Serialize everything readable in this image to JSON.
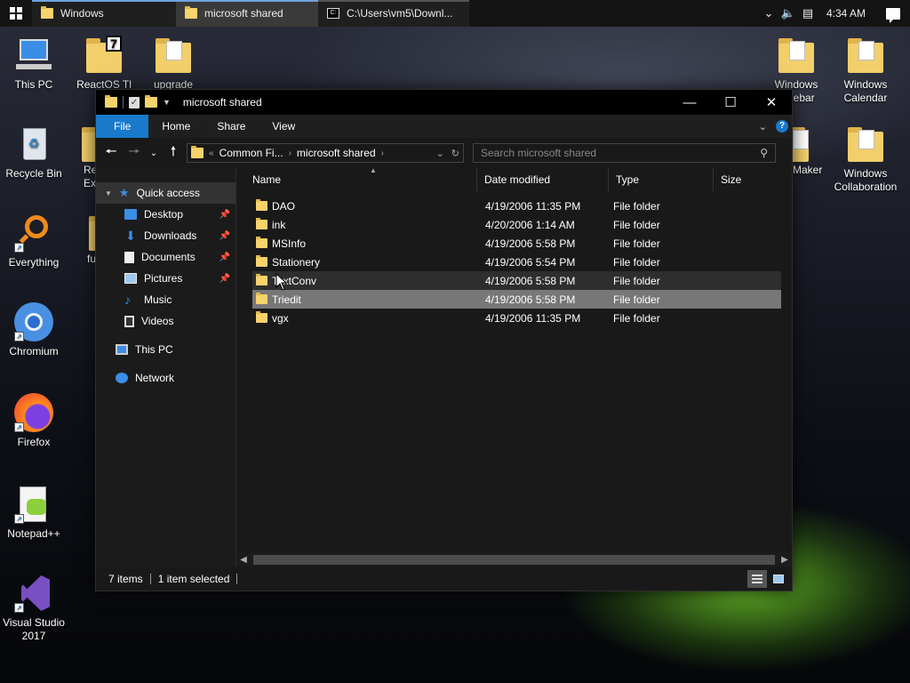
{
  "taskbar": {
    "tasks": [
      {
        "label": "Windows"
      },
      {
        "label": "microsoft shared"
      },
      {
        "label": "C:\\Users\\vm5\\Downl..."
      }
    ],
    "clock": "4:34 AM"
  },
  "desktop": {
    "icons": [
      {
        "label": "This PC"
      },
      {
        "label": "ReactOS Tl"
      },
      {
        "label": "upgrade"
      },
      {
        "label": "Windows Sidebar"
      },
      {
        "label": "Windows Calendar"
      },
      {
        "label": "Recycle Bin"
      },
      {
        "label": "Re Ex"
      },
      {
        "label": "Maker"
      },
      {
        "label": "Windows Collaboration"
      },
      {
        "label": "Everything"
      },
      {
        "label": "fu"
      },
      {
        "label": "Chromium"
      },
      {
        "label": "Firefox"
      },
      {
        "label": "Notepad++"
      },
      {
        "label": "Visual Studio 2017"
      }
    ]
  },
  "explorer": {
    "title": "microsoft shared",
    "ribbon_tabs": [
      "File",
      "Home",
      "Share",
      "View"
    ],
    "address": {
      "overflow": "«",
      "crumbs": [
        "Common Fi...",
        "microsoft shared"
      ]
    },
    "search_placeholder": "Search microsoft shared",
    "nav": {
      "quick_access": "Quick access",
      "items": [
        "Desktop",
        "Downloads",
        "Documents",
        "Pictures",
        "Music",
        "Videos"
      ],
      "this_pc": "This PC",
      "network": "Network"
    },
    "columns": [
      "Name",
      "Date modified",
      "Type",
      "Size"
    ],
    "rows": [
      {
        "name": "DAO",
        "date": "4/19/2006 11:35 PM",
        "type": "File folder"
      },
      {
        "name": "ink",
        "date": "4/20/2006 1:14 AM",
        "type": "File folder"
      },
      {
        "name": "MSInfo",
        "date": "4/19/2006 5:58 PM",
        "type": "File folder"
      },
      {
        "name": "Stationery",
        "date": "4/19/2006 5:54 PM",
        "type": "File folder"
      },
      {
        "name": "TextConv",
        "date": "4/19/2006 5:58 PM",
        "type": "File folder"
      },
      {
        "name": "Triedit",
        "date": "4/19/2006 5:58 PM",
        "type": "File folder"
      },
      {
        "name": "vgx",
        "date": "4/19/2006 11:35 PM",
        "type": "File folder"
      }
    ],
    "status": {
      "count": "7 items",
      "selected": "1 item selected"
    }
  },
  "colors": {
    "accent": "#1979ca",
    "folder": "#f6d36b",
    "selected_row": "#777777"
  }
}
